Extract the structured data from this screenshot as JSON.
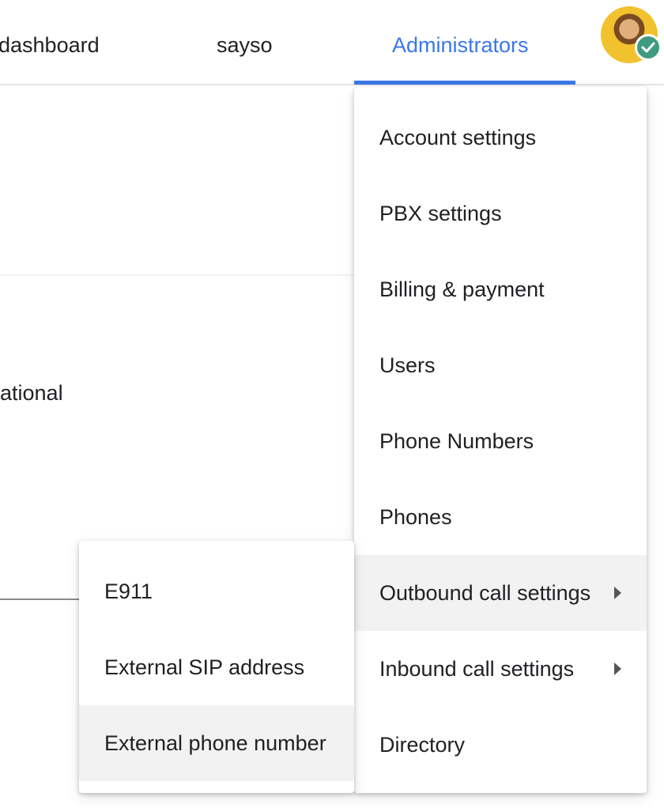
{
  "nav": {
    "tabs": [
      {
        "label": "dashboard"
      },
      {
        "label": "sayso"
      },
      {
        "label": "Administrators",
        "active": true
      }
    ],
    "accent_color": "#3b78e7"
  },
  "avatar": {
    "status_icon": "check-icon",
    "status_color": "#3f9b7f"
  },
  "background": {
    "partial_text": "ational"
  },
  "menu": {
    "items": [
      {
        "label": "Account settings"
      },
      {
        "label": "PBX settings"
      },
      {
        "label": "Billing & payment"
      },
      {
        "label": "Users"
      },
      {
        "label": "Phone Numbers"
      },
      {
        "label": "Phones"
      },
      {
        "label": "Outbound call settings",
        "has_submenu": true,
        "highlighted": true
      },
      {
        "label": "Inbound call settings",
        "has_submenu": true
      },
      {
        "label": "Directory"
      }
    ]
  },
  "submenu": {
    "items": [
      {
        "label": "E911"
      },
      {
        "label": "External SIP address"
      },
      {
        "label": "External phone number",
        "highlighted": true
      }
    ]
  }
}
